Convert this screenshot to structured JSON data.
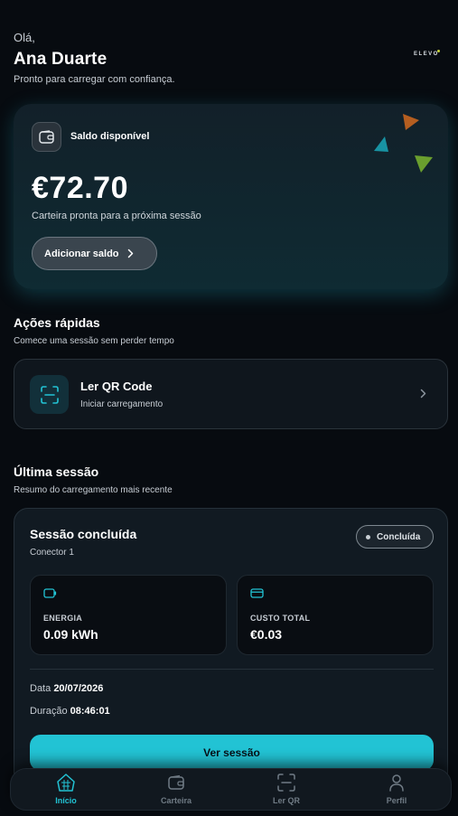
{
  "greeting": {
    "hello": "Olá,",
    "name": "Ana Duarte",
    "subtitle": "Pronto para carregar com confiança.",
    "logo_text": "ELEVO"
  },
  "wallet": {
    "title": "Saldo disponível",
    "amount": "€72.70",
    "subtitle": "Carteira pronta para a próxima sessão",
    "add_button": "Adicionar saldo",
    "icon": "wallet-icon"
  },
  "quick_actions": {
    "title": "Ações rápidas",
    "subtitle": "Comece uma sessão sem perder tempo",
    "qr": {
      "title": "Ler QR Code",
      "subtitle": "Iniciar carregamento",
      "icon": "qr-scan-icon"
    }
  },
  "last_session": {
    "title": "Última sessão",
    "subtitle": "Resumo do carregamento mais recente",
    "card": {
      "title": "Sessão concluída",
      "connector": "Conector 1",
      "status": "Concluída",
      "energy_label": "ENERGIA",
      "energy_value": "0.09 kWh",
      "cost_label": "CUSTO TOTAL",
      "cost_value": "€0.03",
      "date_label": "Data",
      "date_value": "20/07/2026",
      "duration_label": "Duração",
      "duration_value": "08:46:01",
      "view_button": "Ver sessão"
    }
  },
  "nav": {
    "items": [
      {
        "label": "Início",
        "icon": "home-icon",
        "active": true
      },
      {
        "label": "Carteira",
        "icon": "wallet-icon",
        "active": false
      },
      {
        "label": "Ler QR",
        "icon": "qr-scan-icon",
        "active": false
      },
      {
        "label": "Perfil",
        "icon": "user-icon",
        "active": false
      }
    ]
  },
  "colors": {
    "background": "#070b10",
    "accent": "#22c3d4",
    "card": "#111a22",
    "muted_text": "#c7cdd4",
    "logo_triangles": [
      "#d2691e",
      "#1aa7b8",
      "#7ab52f"
    ]
  }
}
